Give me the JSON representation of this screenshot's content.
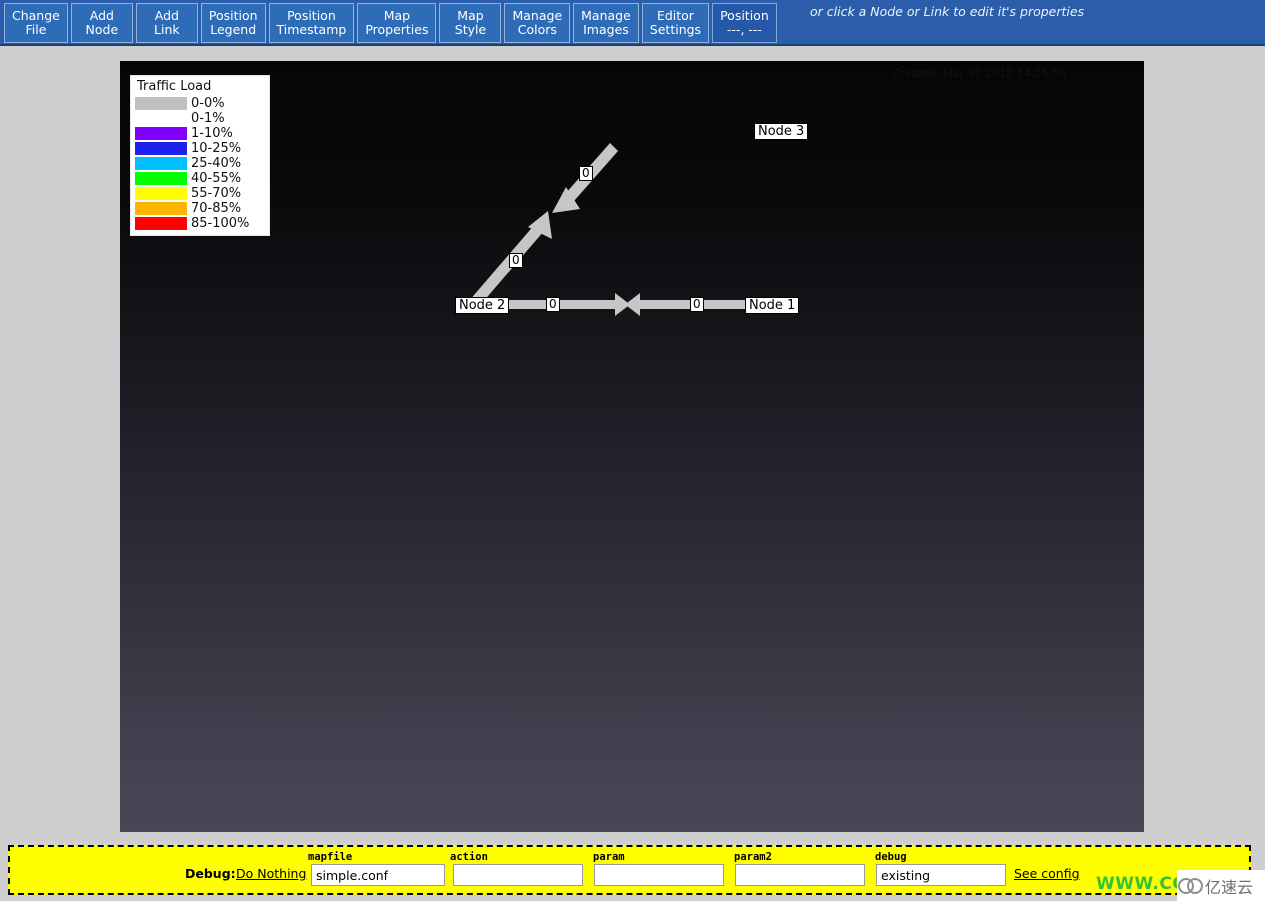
{
  "toolbar": {
    "buttons": [
      {
        "name": "change-file",
        "line1": "Change",
        "line2": "File"
      },
      {
        "name": "add-node",
        "line1": "Add",
        "line2": "Node"
      },
      {
        "name": "add-link",
        "line1": "Add",
        "line2": "Link"
      },
      {
        "name": "position-legend",
        "line1": "Position",
        "line2": "Legend"
      },
      {
        "name": "position-timestamp",
        "line1": "Position",
        "line2": "Timestamp"
      },
      {
        "name": "map-properties",
        "line1": "Map",
        "line2": "Properties"
      },
      {
        "name": "map-style",
        "line1": "Map",
        "line2": "Style"
      },
      {
        "name": "manage-colors",
        "line1": "Manage",
        "line2": "Colors"
      },
      {
        "name": "manage-images",
        "line1": "Manage",
        "line2": "Images"
      },
      {
        "name": "editor-settings",
        "line1": "Editor",
        "line2": "Settings"
      },
      {
        "name": "position-readout",
        "line1": "Position",
        "line2": "---, ---"
      }
    ],
    "hint": "or click a Node or Link to edit it's properties"
  },
  "map": {
    "created_stamp": "Created: Mar 30 2015 14:25:50",
    "legend": {
      "title": "Traffic Load",
      "rows": [
        {
          "label": "0-0%",
          "color": "#c0c0c0"
        },
        {
          "label": "0-1%",
          "color": "#ffffff"
        },
        {
          "label": "1-10%",
          "color": "#8000ff"
        },
        {
          "label": "10-25%",
          "color": "#2020ec"
        },
        {
          "label": "25-40%",
          "color": "#00c0ff"
        },
        {
          "label": "40-55%",
          "color": "#00ff00"
        },
        {
          "label": "55-70%",
          "color": "#ffff00"
        },
        {
          "label": "70-85%",
          "color": "#ffb400"
        },
        {
          "label": "85-100%",
          "color": "#ff0000"
        }
      ]
    },
    "nodes": [
      {
        "name": "node-1",
        "label": "Node 1"
      },
      {
        "name": "node-2",
        "label": "Node 2"
      },
      {
        "name": "node-3",
        "label": "Node 3"
      }
    ],
    "link_labels": [
      {
        "name": "link-label-node2-node1-out",
        "value": "0"
      },
      {
        "name": "link-label-node2-node1-in",
        "value": "0"
      },
      {
        "name": "link-label-node2-node3-out",
        "value": "0"
      },
      {
        "name": "link-label-node2-node3-in",
        "value": "0"
      }
    ]
  },
  "debug": {
    "prefix": "Debug:",
    "do_nothing": "Do Nothing",
    "see_config": "See config",
    "fields": [
      {
        "name": "mapfile",
        "label": "mapfile",
        "value": "simple.conf",
        "placeholder": ""
      },
      {
        "name": "action",
        "label": "action",
        "value": "",
        "placeholder": ""
      },
      {
        "name": "param",
        "label": "param",
        "value": "",
        "placeholder": ""
      },
      {
        "name": "param2",
        "label": "param2",
        "value": "",
        "placeholder": ""
      },
      {
        "name": "debug",
        "label": "debug",
        "value": "existing",
        "placeholder": ""
      }
    ]
  },
  "watermark": {
    "url_text": "WWW.CC",
    "cn_text": "亿速云"
  }
}
